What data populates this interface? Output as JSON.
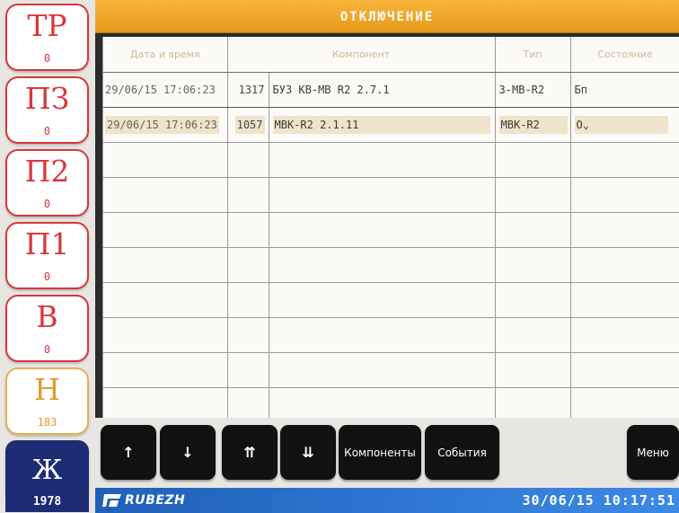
{
  "sidebar": {
    "items": [
      {
        "code": "ТР",
        "count": "0"
      },
      {
        "code": "ПЗ",
        "count": "0"
      },
      {
        "code": "П2",
        "count": "0"
      },
      {
        "code": "П1",
        "count": "0"
      },
      {
        "code": "В",
        "count": "0"
      },
      {
        "code": "Н",
        "count": "183"
      },
      {
        "code": "Ж",
        "count": "1978"
      }
    ]
  },
  "header": {
    "title": "ОТКЛЮЧЕНИЕ"
  },
  "table": {
    "columns": [
      "Дата и время",
      "Компонент",
      "Тип",
      "Состояние"
    ],
    "rows": [
      {
        "time": "29/06/15 17:06:23",
        "num": "1317",
        "component": "БУЗ КВ-МВ R2 2.7.1",
        "type": "З-МВ-R2",
        "state": "Бп"
      },
      {
        "time": "29/06/15 17:06:23",
        "num": "1057",
        "component": "МВК-R2 2.1.11",
        "type": "МВК-R2",
        "state": "О⌄"
      }
    ]
  },
  "buttons": {
    "up": "↑",
    "down": "↓",
    "page_up": "⇈",
    "page_down": "⇊",
    "components": "Компоненты",
    "events": "События",
    "menu": "Меню"
  },
  "footer": {
    "logo": "RUBEZH",
    "datetime": "30/06/15 10:17:51"
  },
  "colors": {
    "alarm": "#d8373a",
    "warning": "#e19b2f",
    "accent": "#1d2c74",
    "header": "#f0a92c"
  }
}
